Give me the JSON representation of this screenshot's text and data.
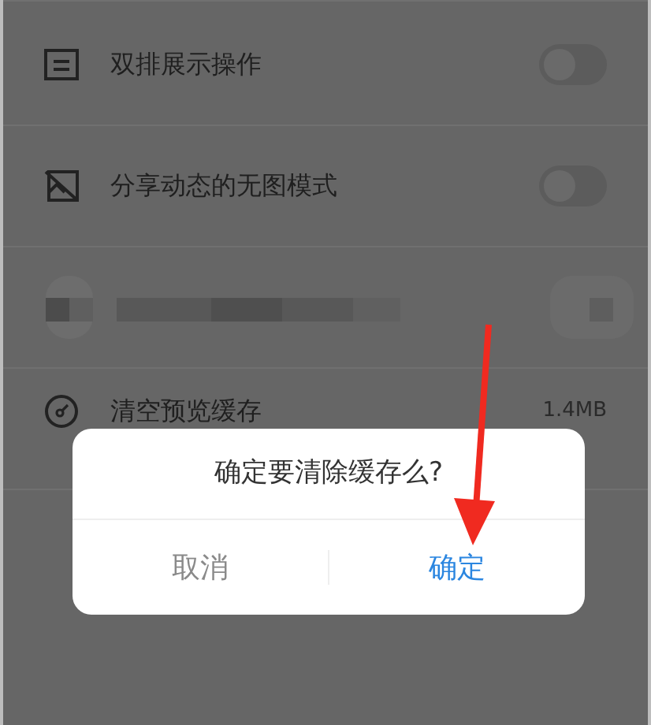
{
  "settings": [
    {
      "kind": "toggle",
      "label": "双排展示操作",
      "on": false
    },
    {
      "kind": "toggle",
      "label": "分享动态的无图模式",
      "on": false
    },
    {
      "kind": "blurred"
    },
    {
      "kind": "value",
      "label": "清空预览缓存",
      "value": "1.4MB"
    }
  ],
  "dialog": {
    "message": "确定要清除缓存么?",
    "buttons": [
      {
        "kind": "cancel",
        "label": "取消"
      },
      {
        "kind": "confirm",
        "label": "确定"
      }
    ]
  }
}
